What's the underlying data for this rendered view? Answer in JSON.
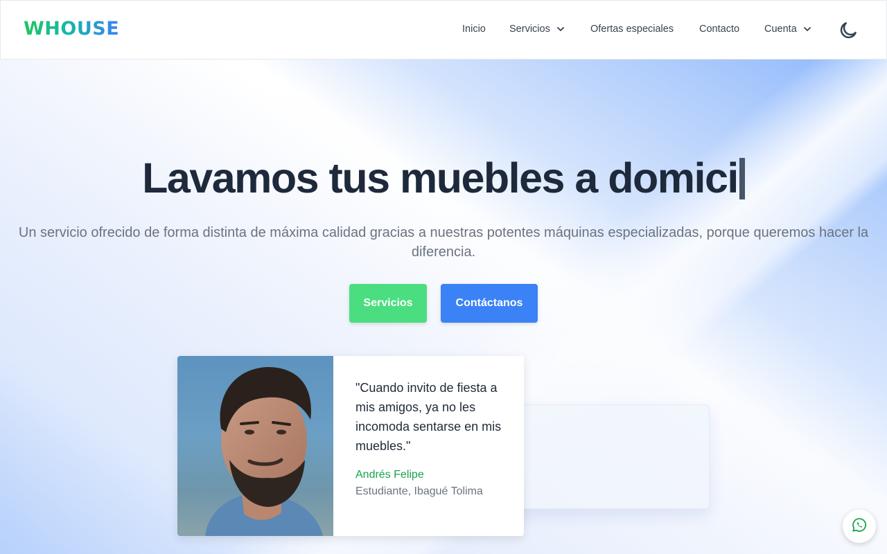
{
  "brand": {
    "logo_text": "WHOUSE",
    "gradient": [
      "#22c55e",
      "#14b8a6",
      "#3b82f6"
    ]
  },
  "nav": {
    "items": [
      {
        "label": "Inicio"
      },
      {
        "label": "Servicios",
        "dropdown": true
      },
      {
        "label": "Ofertas especiales"
      },
      {
        "label": "Contacto"
      },
      {
        "label": "Cuenta",
        "dropdown": true
      }
    ],
    "theme_toggle_icon": "moon-icon"
  },
  "hero": {
    "title": "Lavamos tus muebles a domici",
    "subtitle": "Un servicio ofrecido de forma distinta de máxima calidad gracias a nuestras potentes máquinas especializadas, porque queremos hacer la diferencia.",
    "buttons": [
      {
        "label": "Servicios",
        "color": "#4ade80"
      },
      {
        "label": "Contáctanos",
        "color": "#3b82f6"
      }
    ]
  },
  "testimonial": {
    "quote": "\"Cuando invito de fiesta a mis amigos, ya no les incomoda sentarse en mis muebles.\"",
    "author": "Andrés Felipe",
    "role": "Estudiante, Ibagué Tolima",
    "author_color": "#16a34a"
  },
  "whatsapp": {
    "icon": "whatsapp-icon",
    "color": "#16a34a"
  }
}
